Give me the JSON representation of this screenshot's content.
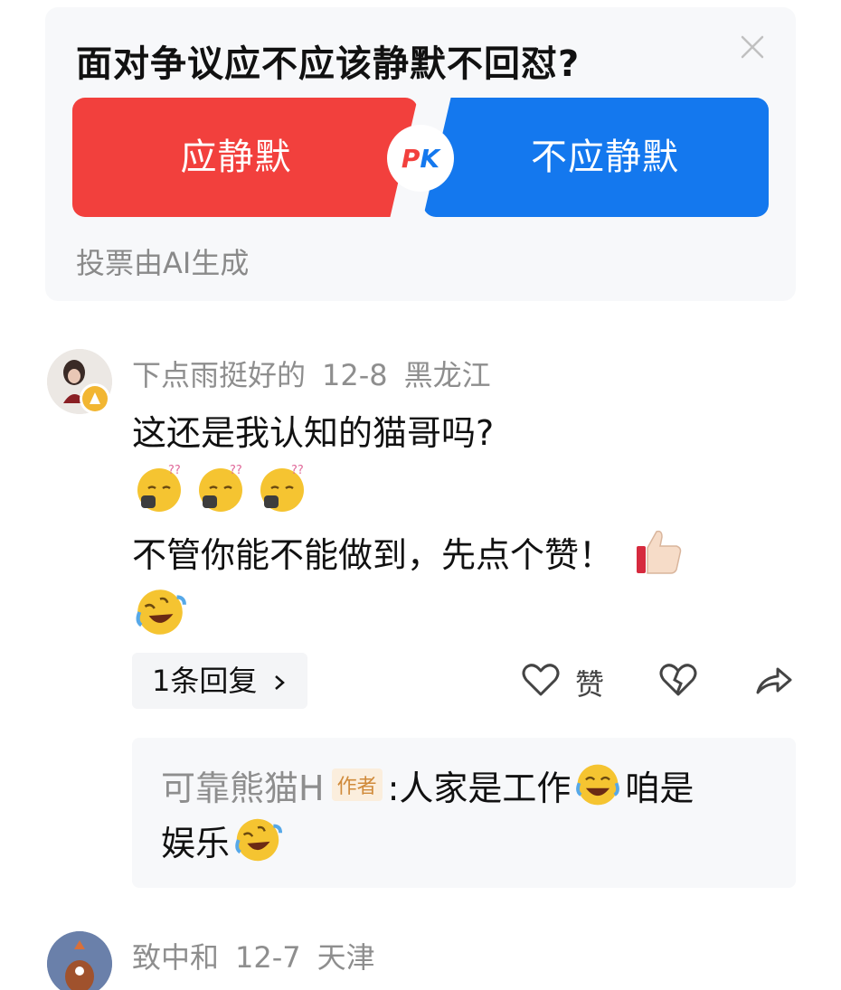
{
  "poll": {
    "title": "面对争议应不应该静默不回怼?",
    "option_left": "应静默",
    "option_right": "不应静默",
    "pk_p": "P",
    "pk_k": "K",
    "note": "投票由AI生成",
    "colors": {
      "left": "#f2403d",
      "right": "#1478ee"
    }
  },
  "comment1": {
    "username": "下点雨挺好的",
    "date": "12-8",
    "location": "黑龙江",
    "line1": "这还是我认知的猫哥吗?",
    "emoji_row": [
      "thinking-sleepy-emoji",
      "thinking-sleepy-emoji",
      "thinking-sleepy-emoji"
    ],
    "line2": "不管你能不能做到，先点个赞！",
    "thumb_icon": "thumbs-up-emoji",
    "laugh_icon": "rofl-emoji",
    "reply_count": "1条回复",
    "like_label": "赞",
    "reply": {
      "user": "可靠熊猫H",
      "author_tag": "作者",
      "text_a": ":人家是工作",
      "text_b": "咱是",
      "text_c": "娱乐"
    }
  },
  "comment2": {
    "username": "致中和",
    "date": "12-7",
    "location": "天津"
  }
}
